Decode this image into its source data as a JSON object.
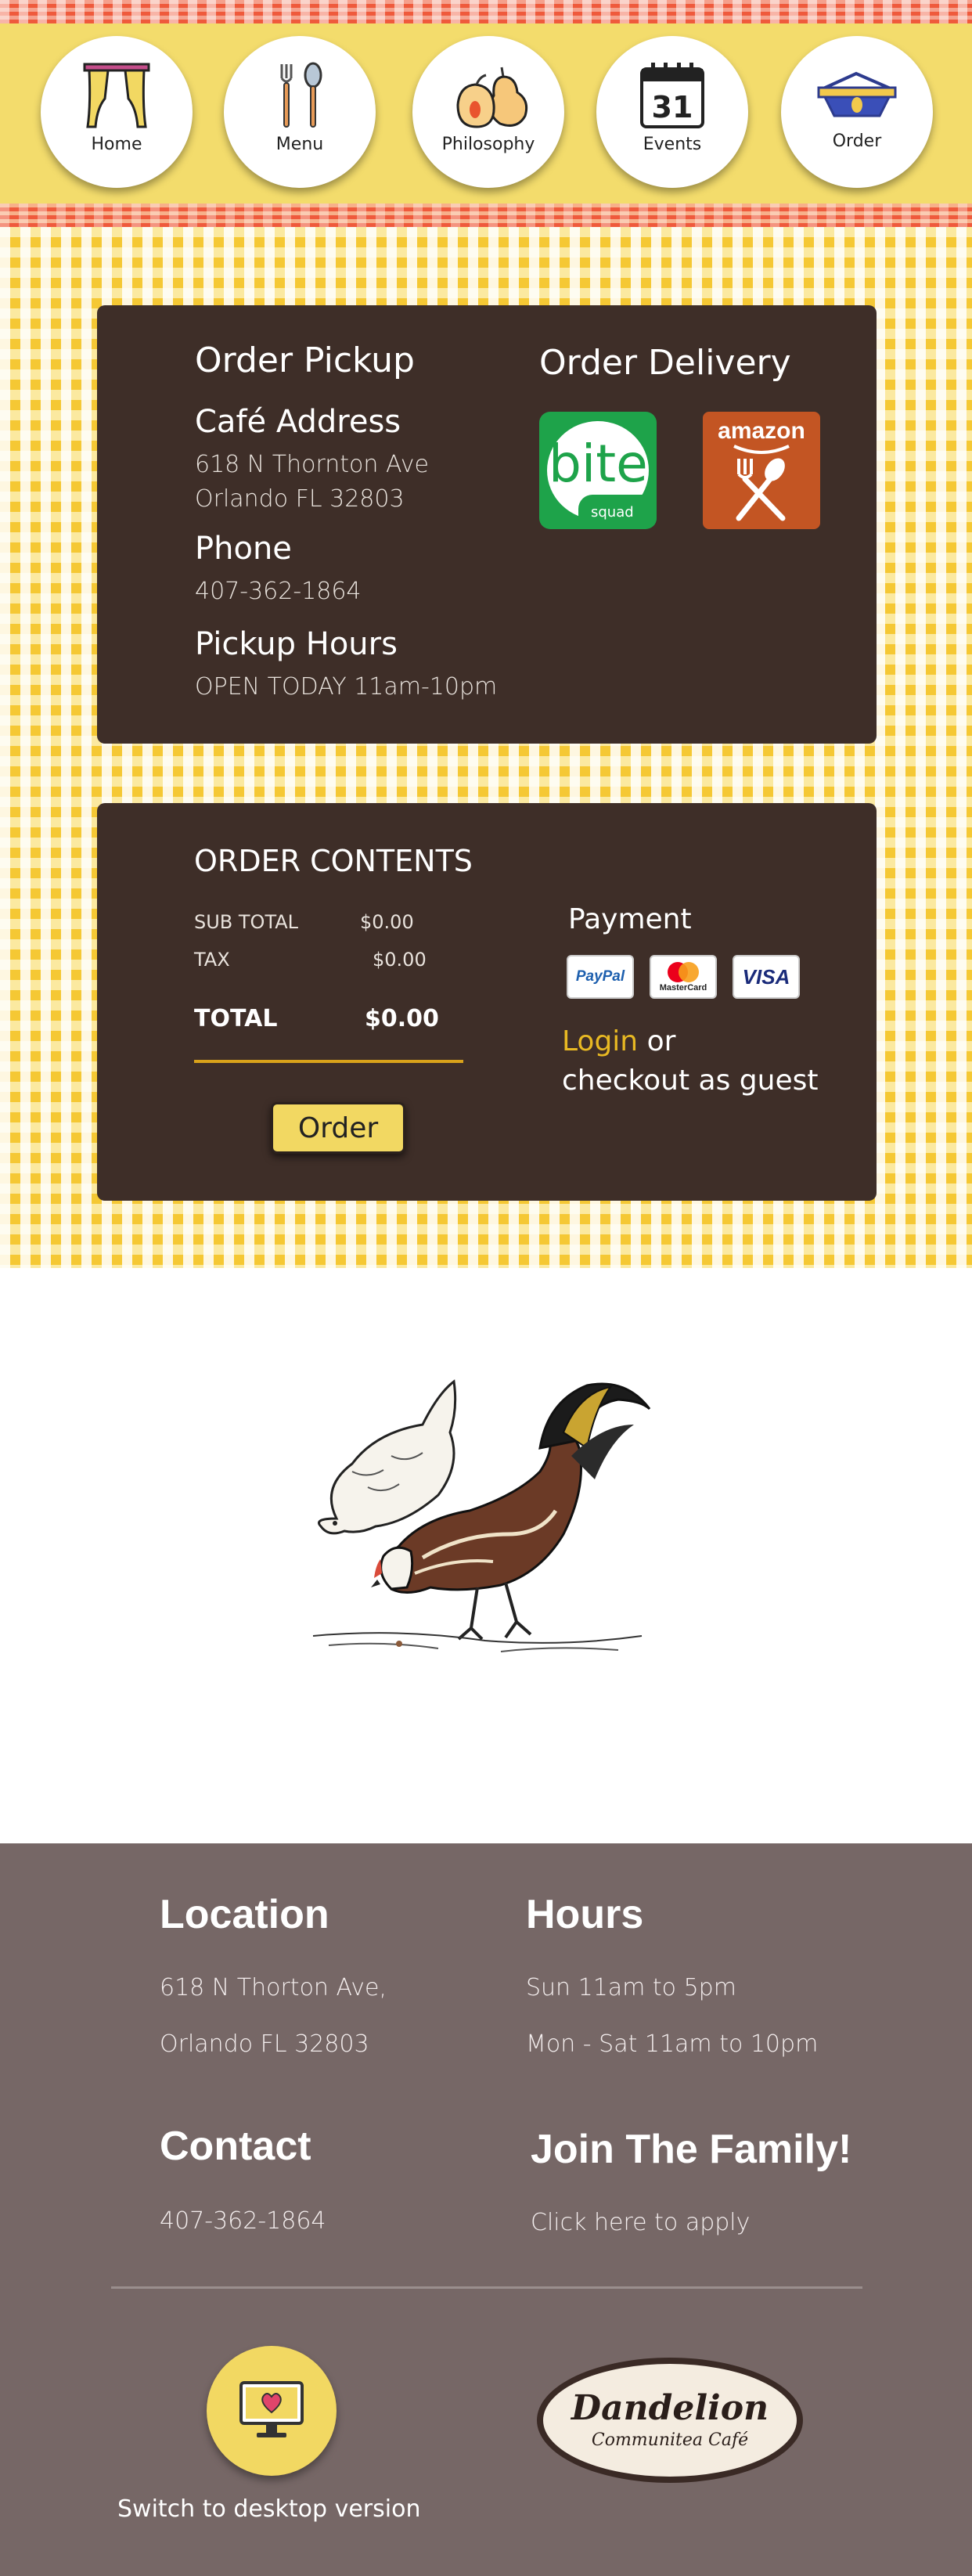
{
  "nav": {
    "items": [
      {
        "label": "Home",
        "icon": "curtain-icon"
      },
      {
        "label": "Menu",
        "icon": "fork-spoon-icon"
      },
      {
        "label": "Philosophy",
        "icon": "pear-icon"
      },
      {
        "label": "Events",
        "icon": "calendar-icon"
      },
      {
        "label": "Order",
        "icon": "basket-icon"
      }
    ],
    "calendar_day": "31"
  },
  "pickup": {
    "title": "Order Pickup",
    "address_heading": "Café Address",
    "address_line1": "618 N Thornton Ave",
    "address_line2": "Orlando FL 32803",
    "phone_heading": "Phone",
    "phone": "407-362-1864",
    "hours_heading": "Pickup Hours",
    "hours": "OPEN TODAY 11am-10pm"
  },
  "delivery": {
    "title": "Order Delivery",
    "bite_logo_text": "bite",
    "bite_logo_sub": "squad",
    "amazon_logo_text": "amazon"
  },
  "order": {
    "title": "ORDER CONTENTS",
    "subtotal_label": "SUB TOTAL",
    "subtotal_value": "$0.00",
    "tax_label": "TAX",
    "tax_value": "$0.00",
    "total_label": "TOTAL",
    "total_value": "$0.00",
    "button": "Order"
  },
  "payment": {
    "title": "Payment",
    "cards": [
      "PayPal",
      "MasterCard",
      "VISA"
    ],
    "login_link": "Login",
    "login_suffix": " or",
    "guest_text": "checkout as guest"
  },
  "footer": {
    "location_heading": "Location",
    "location_line1": "618 N Thorton Ave,",
    "location_line2": "Orlando FL 32803",
    "hours_heading": "Hours",
    "hours_line1": "Sun 11am to 5pm",
    "hours_line2": "Mon - Sat 11am to 10pm",
    "contact_heading": "Contact",
    "contact_phone": "407-362-1864",
    "family_heading": "Join The Family!",
    "family_link": "Click here to apply",
    "desktop_label": "Switch to desktop version",
    "logo_title": "Dandelion",
    "logo_sub": "Communitea Café"
  },
  "colors": {
    "nav_yellow": "#f3dc6c",
    "stripe_red": "#ef5a3c",
    "card_brown": "#3e2e28",
    "accent_gold": "#e8b923",
    "footer_gray": "#766766"
  }
}
